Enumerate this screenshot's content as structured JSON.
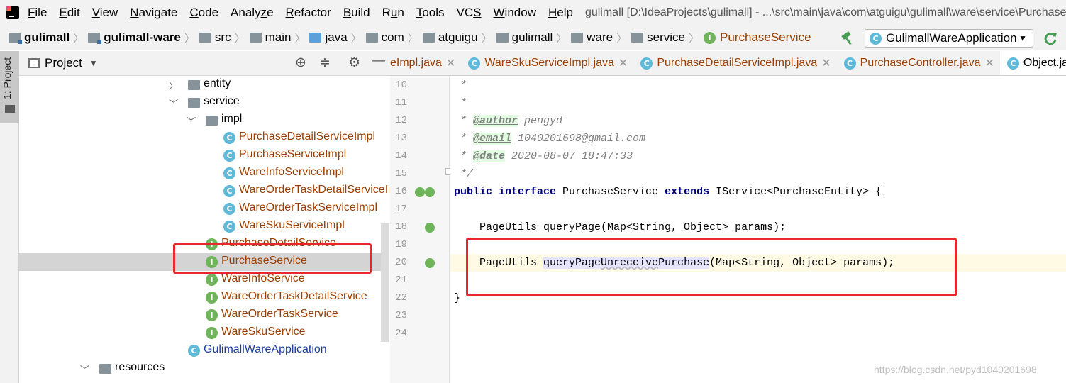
{
  "menubar": {
    "items": [
      "File",
      "Edit",
      "View",
      "Navigate",
      "Code",
      "Analyze",
      "Refactor",
      "Build",
      "Run",
      "Tools",
      "VCS",
      "Window",
      "Help"
    ],
    "mnemonics": [
      "F",
      "E",
      "V",
      "N",
      "C",
      "z",
      "R",
      "B",
      "u",
      "T",
      "S",
      "W",
      "H"
    ],
    "window_title": "gulimall [D:\\IdeaProjects\\gulimall] - ...\\src\\main\\java\\com\\atguigu\\gulimall\\ware\\service\\PurchaseService.java"
  },
  "breadcrumb": {
    "items": [
      "gulimall",
      "gulimall-ware",
      "src",
      "main",
      "java",
      "com",
      "atguigu",
      "gulimall",
      "ware",
      "service",
      "PurchaseService"
    ]
  },
  "run_config": {
    "label": "GulimallWareApplication"
  },
  "left_strip": {
    "project_tab": "1: Project"
  },
  "project_panel": {
    "title": "Project"
  },
  "tree": [
    {
      "label": "entity",
      "type": "package",
      "indent": 1,
      "expanded": false
    },
    {
      "label": "service",
      "type": "package",
      "indent": 1,
      "expanded": true
    },
    {
      "label": "impl",
      "type": "package",
      "indent": 2,
      "expanded": true
    },
    {
      "label": "PurchaseDetailServiceImpl",
      "type": "class",
      "indent": 3
    },
    {
      "label": "PurchaseServiceImpl",
      "type": "class",
      "indent": 3
    },
    {
      "label": "WareInfoServiceImpl",
      "type": "class",
      "indent": 3
    },
    {
      "label": "WareOrderTaskDetailServiceImpl",
      "type": "class",
      "indent": 3
    },
    {
      "label": "WareOrderTaskServiceImpl",
      "type": "class",
      "indent": 3
    },
    {
      "label": "WareSkuServiceImpl",
      "type": "class",
      "indent": 3
    },
    {
      "label": "PurchaseDetailService",
      "type": "interface",
      "indent": 2
    },
    {
      "label": "PurchaseService",
      "type": "interface",
      "indent": 2,
      "selected": true
    },
    {
      "label": "WareInfoService",
      "type": "interface",
      "indent": 2
    },
    {
      "label": "WareOrderTaskDetailService",
      "type": "interface",
      "indent": 2
    },
    {
      "label": "WareOrderTaskService",
      "type": "interface",
      "indent": 2
    },
    {
      "label": "WareSkuService",
      "type": "interface",
      "indent": 2
    },
    {
      "label": "GulimallWareApplication",
      "type": "app",
      "indent": 1
    },
    {
      "label": "resources",
      "type": "resources",
      "indent": 0,
      "expanded": true
    }
  ],
  "editor_tabs": [
    {
      "label": "eImpl.java",
      "icon": "none"
    },
    {
      "label": "WareSkuServiceImpl.java",
      "icon": "class"
    },
    {
      "label": "PurchaseDetailServiceImpl.java",
      "icon": "class"
    },
    {
      "label": "PurchaseController.java",
      "icon": "class"
    },
    {
      "label": "Object.ja",
      "icon": "class",
      "active": true
    }
  ],
  "code": {
    "lines": [
      {
        "n": "10",
        "html": "<span class=\"cm\"> *</span>"
      },
      {
        "n": "11",
        "html": "<span class=\"cm\"> *</span>"
      },
      {
        "n": "12",
        "html": "<span class=\"cm\"> * </span><span class=\"tag\">@author</span><span class=\"cm\"> pengyd</span>"
      },
      {
        "n": "13",
        "html": "<span class=\"cm\"> * </span><span class=\"tag\">@email</span><span class=\"cm\"> 1040201698@gmail.com</span>"
      },
      {
        "n": "14",
        "html": "<span class=\"cm\"> * </span><span class=\"tag\">@date</span><span class=\"cm\"> 2020-08-07 18:47:33</span>"
      },
      {
        "n": "15",
        "html": "<span class=\"cm\"> */</span>"
      },
      {
        "n": "16",
        "html": "<span class=\"kw\">public interface</span> PurchaseService <span class=\"kw\">extends</span> IService&lt;PurchaseEntity&gt; {"
      },
      {
        "n": "17",
        "html": ""
      },
      {
        "n": "18",
        "html": "    PageUtils queryPage(Map&lt;String, Object&gt; params);"
      },
      {
        "n": "19",
        "html": ""
      },
      {
        "n": "20",
        "html": "    PageUtils <span class=\"hl\">queryPage<span class=\"unl\">Unreceive</span>Purchase</span>(Map&lt;String, Object&gt; params);"
      },
      {
        "n": "21",
        "html": ""
      },
      {
        "n": "22",
        "html": "}"
      },
      {
        "n": "23",
        "html": ""
      },
      {
        "n": "24",
        "html": ""
      }
    ]
  },
  "watermark": "https://blog.csdn.net/pyd1040201698",
  "colors": {
    "highlight_box": "#e8262d",
    "class_name": "#9b3e00",
    "keyword": "#000080"
  }
}
